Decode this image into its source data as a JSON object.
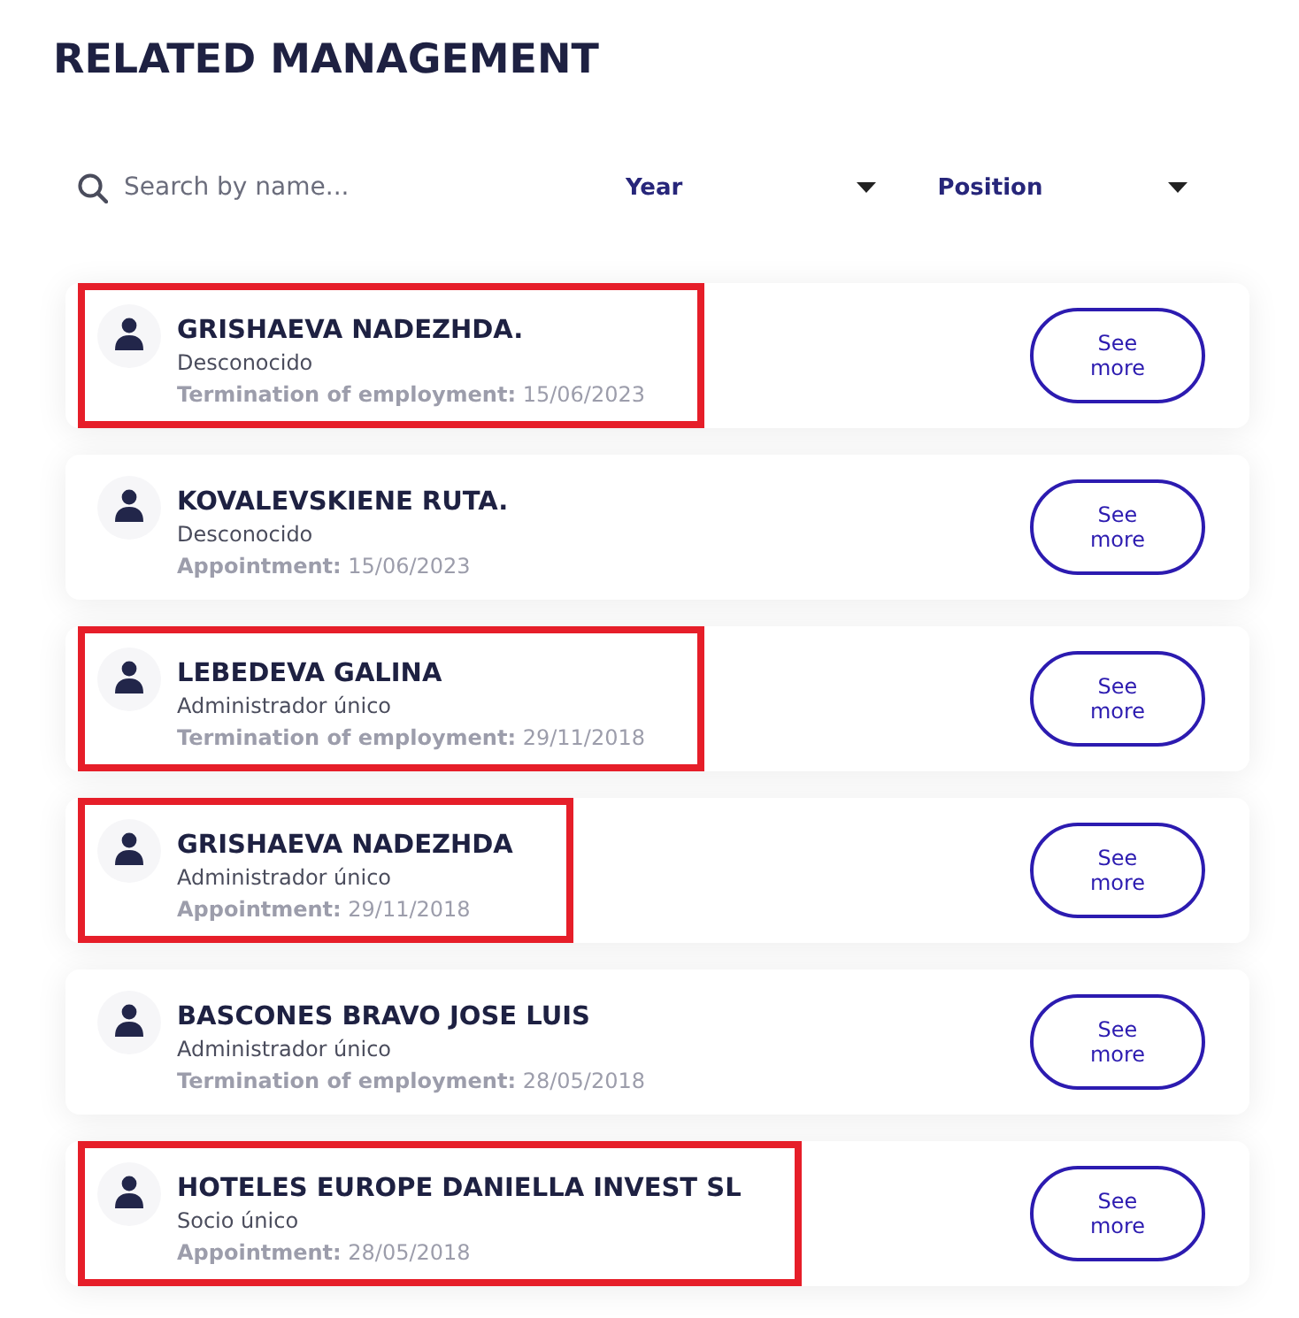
{
  "title": "RELATED MANAGEMENT",
  "filters": {
    "search": {
      "placeholder": "Search by name..."
    },
    "dropdowns": [
      {
        "label": "Year"
      },
      {
        "label": "Position"
      }
    ]
  },
  "managers": [
    {
      "name": "GRISHAEVA NADEZHDA.",
      "role": "Desconocido",
      "event": "**Termination of employment:** 15/06/2023",
      "highlighted": true,
      "button": "See more"
    },
    {
      "name": "KOVALEVSKIENE RUTA.",
      "role": "Desconocido",
      "event": "**Appointment:** 15/06/2023",
      "highlighted": false,
      "button": "See more"
    },
    {
      "name": "LEBEDEVA GALINA",
      "role": "Administrador único",
      "event": "**Termination of employment:** 29/11/2018",
      "highlighted": true,
      "button": "See more"
    },
    {
      "name": "GRISHAEVA NADEZHDA",
      "role": "Administrador único",
      "event": "**Appointment:** 29/11/2018",
      "highlighted": true,
      "button": "See more"
    },
    {
      "name": "BASCONES BRAVO JOSE LUIS",
      "role": "Administrador único",
      "event": "**Termination of employment:** 28/05/2018",
      "highlighted": false,
      "button": "See more"
    },
    {
      "name": "HOTELES EUROPE DANIELLA INVEST SL",
      "role": "Socio único",
      "event": "**Appointment:** 28/05/2018",
      "highlighted": true,
      "button": "See more"
    }
  ]
}
